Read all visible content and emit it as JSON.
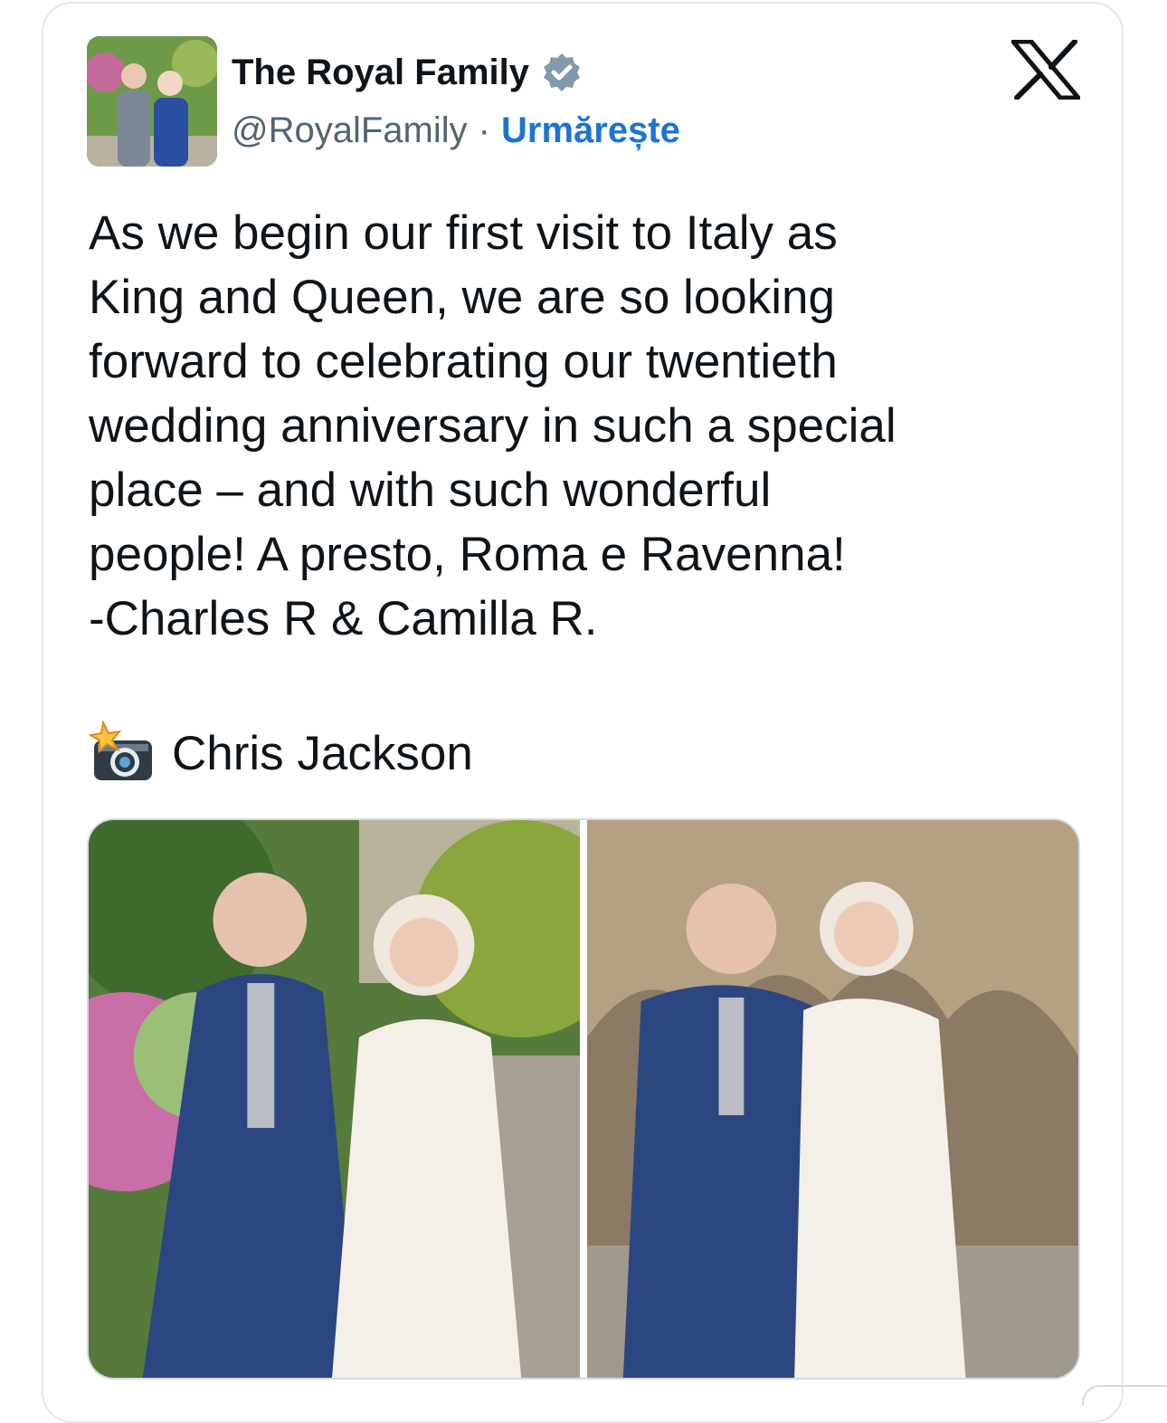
{
  "author": {
    "name": "The Royal Family",
    "handle": "@RoyalFamily",
    "separator": "·",
    "follow_label": "Urmărește",
    "verified_icon": "verified-badge-icon",
    "verified_color": "#829aab"
  },
  "tweet": {
    "text": "As we begin our first visit to Italy as\nKing and Queen, we are so looking\nforward to celebrating our twentieth\nwedding anniversary in such a special\nplace – and with such wonderful\npeople! A presto, Roma e Ravenna!\n-Charles R & Camilla R.",
    "photo_credit_icon": "camera-flash-icon",
    "photo_credit": "Chris Jackson"
  },
  "media": {
    "photos": [
      {
        "scene": "garden-portrait"
      },
      {
        "scene": "grotto-portrait"
      }
    ]
  },
  "colors": {
    "accent": "#1d74d1",
    "secondary_text": "#536471",
    "border": "#e3e6e9"
  }
}
